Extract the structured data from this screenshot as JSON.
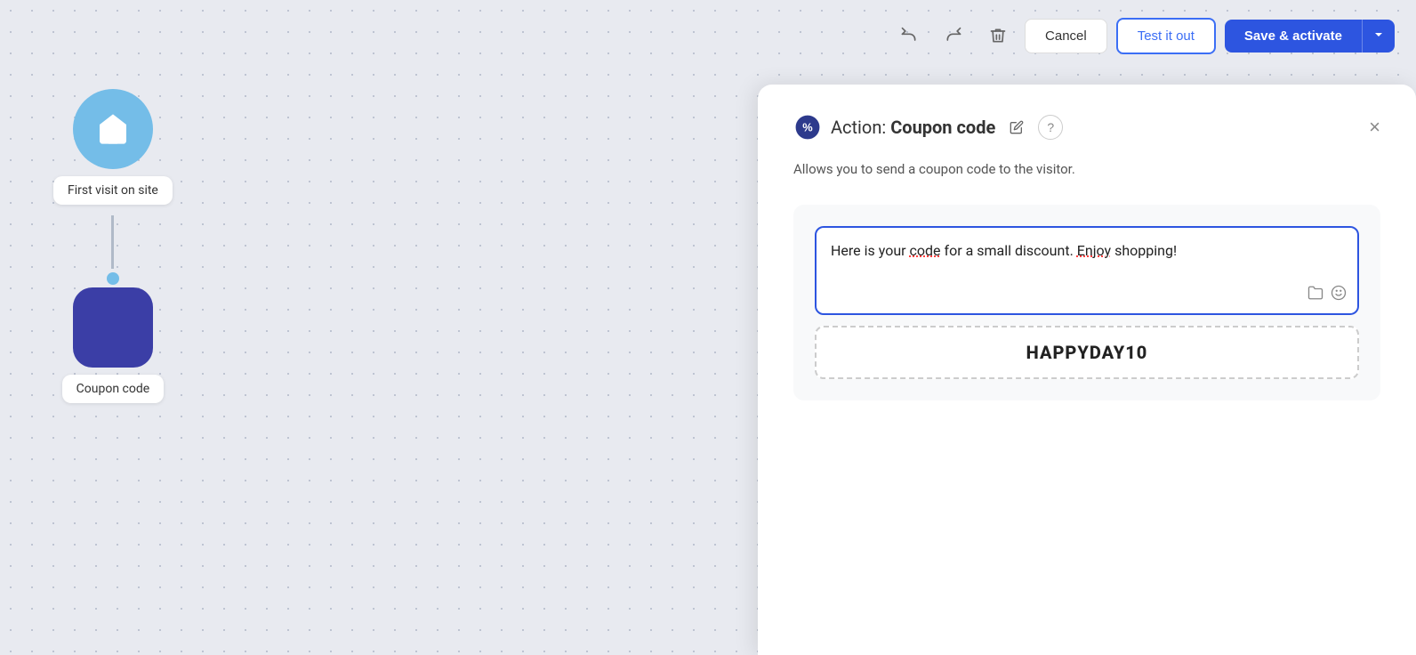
{
  "toolbar": {
    "undo_label": "↺",
    "redo_label": "↻",
    "delete_label": "🗑",
    "cancel_label": "Cancel",
    "test_label": "Test it out",
    "save_label": "Save & activate",
    "dropdown_label": "▾"
  },
  "flow": {
    "trigger_node": {
      "label": "First visit on site"
    },
    "action_node": {
      "label": "Coupon code"
    }
  },
  "panel": {
    "title_prefix": "Action: ",
    "title": "Coupon code",
    "description": "Allows you to send a coupon code to the visitor.",
    "message": "Here is your code for a small discount. Enjoy shopping!",
    "coupon_code": "HAPPYDAY10",
    "close_label": "×",
    "edit_label": "✏",
    "help_label": "?"
  }
}
